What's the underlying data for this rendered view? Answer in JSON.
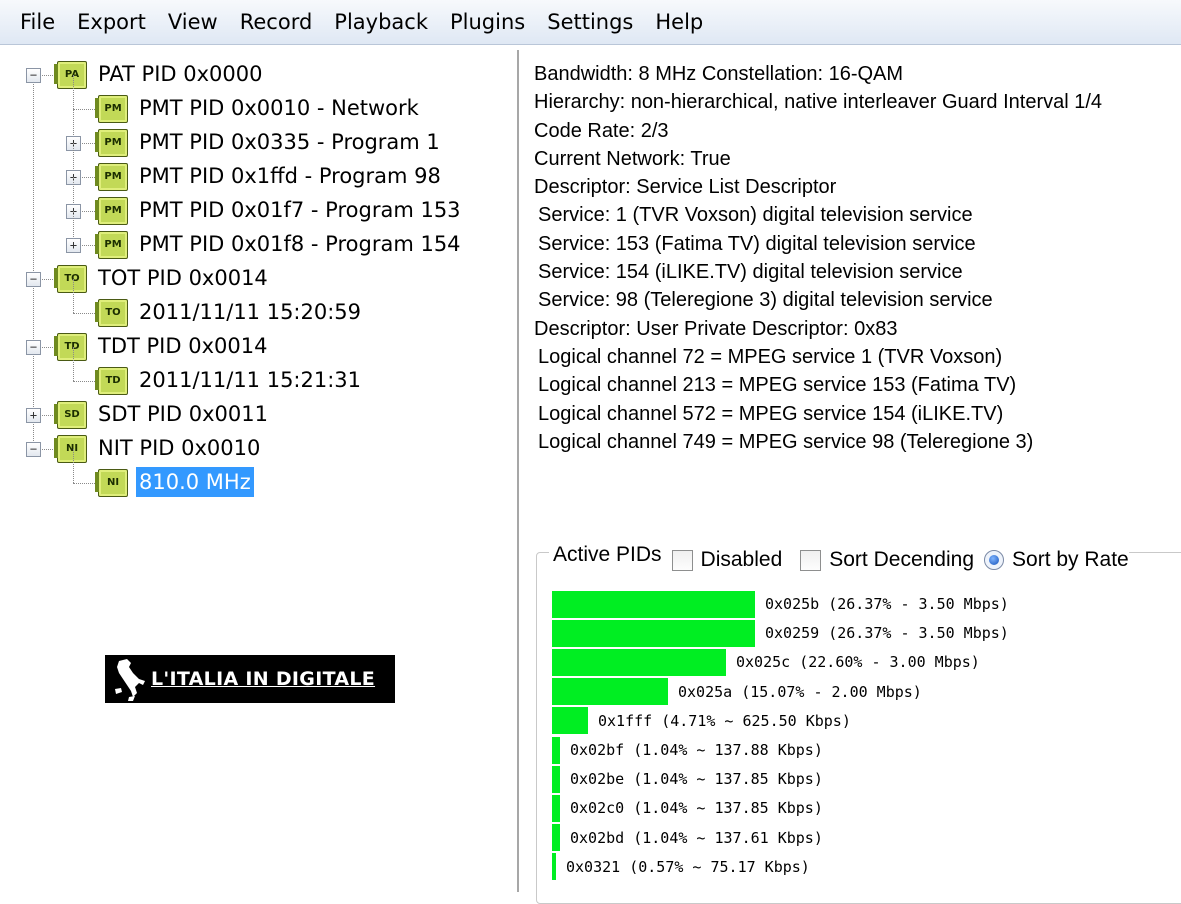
{
  "menu": [
    "File",
    "Export",
    "View",
    "Record",
    "Playback",
    "Plugins",
    "Settings",
    "Help"
  ],
  "tree": [
    {
      "label": "PAT PID 0x0000",
      "icon": "PAT",
      "level": 0,
      "expander": "−"
    },
    {
      "label": "PMT PID 0x0010 - Network",
      "icon": "PMT",
      "level": 1,
      "expander": ""
    },
    {
      "label": "PMT PID 0x0335 - Program 1",
      "icon": "PMT",
      "level": 1,
      "expander": "+"
    },
    {
      "label": "PMT PID 0x1ffd - Program 98",
      "icon": "PMT",
      "level": 1,
      "expander": "+"
    },
    {
      "label": "PMT PID 0x01f7 - Program 153",
      "icon": "PMT",
      "level": 1,
      "expander": "+"
    },
    {
      "label": "PMT PID 0x01f8 - Program 154",
      "icon": "PMT",
      "level": 1,
      "expander": "+"
    },
    {
      "label": "TOT PID 0x0014",
      "icon": "TOT",
      "level": 0,
      "expander": "−"
    },
    {
      "label": "2011/11/11 15:20:59",
      "icon": "TOT",
      "level": 1,
      "expander": ""
    },
    {
      "label": "TDT PID 0x0014",
      "icon": "TDT",
      "level": 0,
      "expander": "−"
    },
    {
      "label": "2011/11/11 15:21:31",
      "icon": "TDT",
      "level": 1,
      "expander": ""
    },
    {
      "label": "SDT PID 0x0011",
      "icon": "SDT",
      "level": 0,
      "expander": "+"
    },
    {
      "label": "NIT PID 0x0010",
      "icon": "NIT",
      "level": 0,
      "expander": "−"
    },
    {
      "label": "810.0 MHz",
      "icon": "NIT",
      "level": 1,
      "expander": "",
      "selected": true
    }
  ],
  "logo": {
    "text": "L'ITALIA IN DIGITALE"
  },
  "details": [
    {
      "text": "Bandwidth: 8 MHz Constellation: 16-QAM",
      "indent": false
    },
    {
      "text": "Hierarchy: non-hierarchical, native interleaver Guard Interval 1/4",
      "indent": false
    },
    {
      "text": "Code Rate: 2/3",
      "indent": false
    },
    {
      "text": "Current Network: True",
      "indent": false
    },
    {
      "text": "Descriptor: Service List Descriptor",
      "indent": false
    },
    {
      "text": "Service: 1 (TVR Voxson) digital television service",
      "indent": true
    },
    {
      "text": "Service: 153 (Fatima TV) digital television service",
      "indent": true
    },
    {
      "text": "Service: 154 (iLIKE.TV) digital television service",
      "indent": true
    },
    {
      "text": "Service: 98 (Teleregione 3) digital television service",
      "indent": true
    },
    {
      "text": "Descriptor: User Private Descriptor: 0x83",
      "indent": false
    },
    {
      "text": "Logical channel 72 = MPEG service 1 (TVR Voxson)",
      "indent": true
    },
    {
      "text": "Logical channel 213 = MPEG service 153 (Fatima TV)",
      "indent": true
    },
    {
      "text": "Logical channel 572 = MPEG service 154 (iLIKE.TV)",
      "indent": true
    },
    {
      "text": "Logical channel 749 = MPEG service 98 (Teleregione 3)",
      "indent": true
    }
  ],
  "active_pids": {
    "title": "Active PIDs",
    "disabled_label": "Disabled",
    "disabled_checked": false,
    "sort_desc_label": "Sort Decending",
    "sort_desc_checked": false,
    "sort_rate_label": "Sort by Rate",
    "sort_rate_selected": true,
    "bar_color": "#00ee22",
    "rows": [
      {
        "pid": "0x025b",
        "percent": 26.37,
        "text": "0x025b (26.37% - 3.50 Mbps)"
      },
      {
        "pid": "0x0259",
        "percent": 26.37,
        "text": "0x0259 (26.37% - 3.50 Mbps)"
      },
      {
        "pid": "0x025c",
        "percent": 22.6,
        "text": "0x025c (22.60% - 3.00 Mbps)"
      },
      {
        "pid": "0x025a",
        "percent": 15.07,
        "text": "0x025a (15.07% - 2.00 Mbps)"
      },
      {
        "pid": "0x1fff",
        "percent": 4.71,
        "text": "0x1fff (4.71% ~ 625.50 Kbps)"
      },
      {
        "pid": "0x02bf",
        "percent": 1.04,
        "text": "0x02bf (1.04% ~ 137.88 Kbps)"
      },
      {
        "pid": "0x02be",
        "percent": 1.04,
        "text": "0x02be (1.04% ~ 137.85 Kbps)"
      },
      {
        "pid": "0x02c0",
        "percent": 1.04,
        "text": "0x02c0 (1.04% ~ 137.85 Kbps)"
      },
      {
        "pid": "0x02bd",
        "percent": 1.04,
        "text": "0x02bd (1.04% ~ 137.61 Kbps)"
      },
      {
        "pid": "0x0321",
        "percent": 0.57,
        "text": "0x0321 (0.57% ~ 75.17 Kbps)"
      }
    ]
  }
}
